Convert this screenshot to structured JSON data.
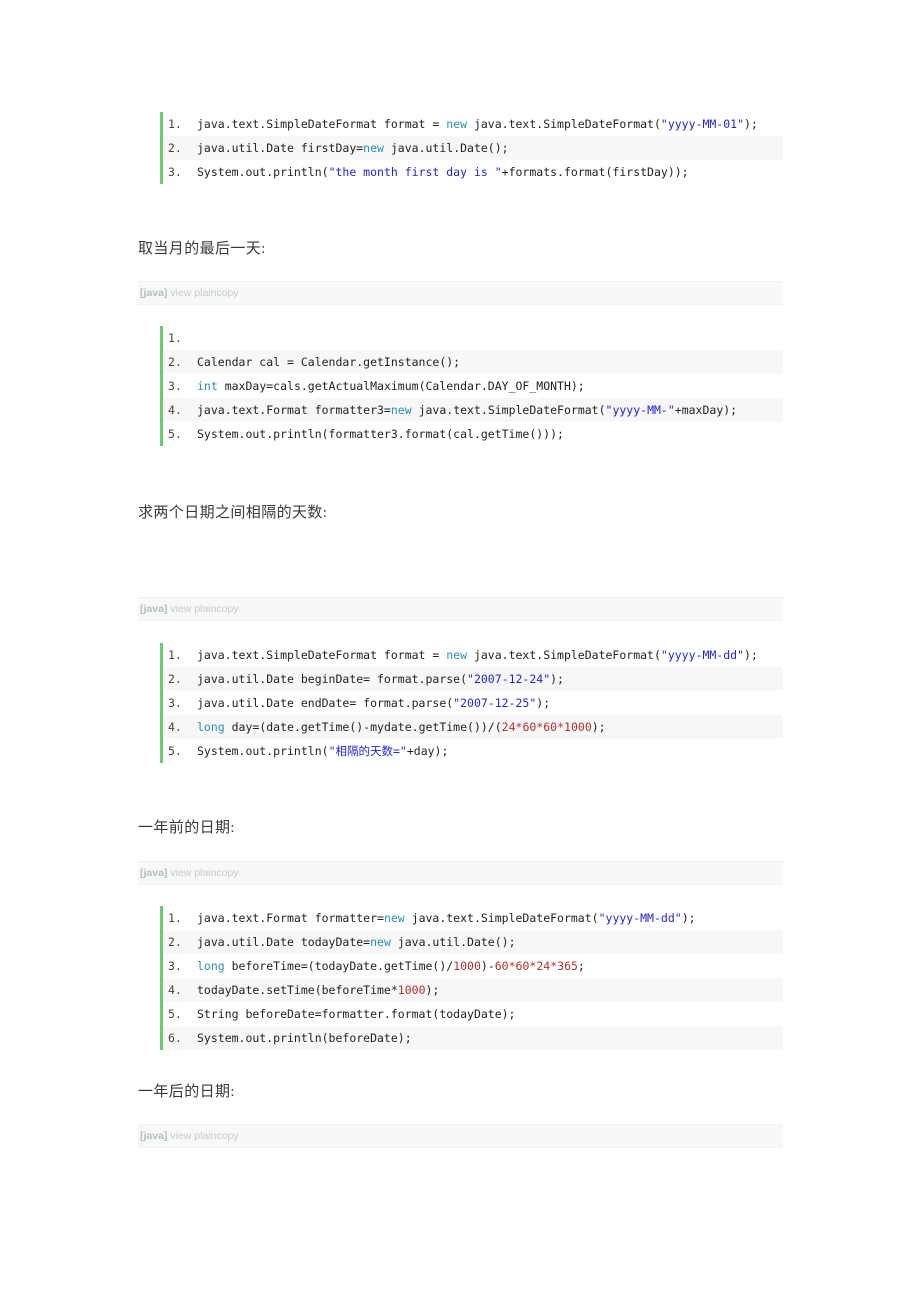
{
  "colors": {
    "keyword": "#2b91af",
    "string": "#2323dc",
    "number": "#b03030",
    "plain": "#1f1f1f",
    "code_accent_bar": "#6ccb6c",
    "toolbar_bg": "#f7f8f8",
    "alt_row_bg": "#f7f7f7",
    "heading_text": "#3a3a3a"
  },
  "toolbar": {
    "lang_label": "[java]",
    "view_label": " view plaincopy"
  },
  "sections": [
    {
      "id": "block-first-day",
      "heading": null,
      "toolbar": false,
      "lines": [
        {
          "num": "1.",
          "tokens": [
            {
              "t": "java.text.SimpleDateFormat format = ",
              "c": "p"
            },
            {
              "t": "new",
              "c": "k"
            },
            {
              "t": " java.text.SimpleDateFormat(",
              "c": "p"
            },
            {
              "t": "\"yyyy-MM-01\"",
              "c": "s"
            },
            {
              "t": ");",
              "c": "p"
            }
          ]
        },
        {
          "num": "2.",
          "tokens": [
            {
              "t": "java.util.Date firstDay=",
              "c": "p"
            },
            {
              "t": "new",
              "c": "k"
            },
            {
              "t": " java.util.Date();",
              "c": "p"
            }
          ]
        },
        {
          "num": "3.",
          "tokens": [
            {
              "t": "System.out.println(",
              "c": "p"
            },
            {
              "t": "\"the month first day is \"",
              "c": "s"
            },
            {
              "t": "+formats.format(firstDay));",
              "c": "p"
            }
          ]
        }
      ]
    },
    {
      "id": "block-last-day",
      "heading": "取当月的最后一天:",
      "toolbar": true,
      "lines": [
        {
          "num": "1.",
          "tokens": [
            {
              "t": "",
              "c": "p"
            }
          ]
        },
        {
          "num": "2.",
          "tokens": [
            {
              "t": "Calendar cal = Calendar.getInstance();",
              "c": "p"
            }
          ]
        },
        {
          "num": "3.",
          "tokens": [
            {
              "t": "int",
              "c": "k"
            },
            {
              "t": " maxDay=cals.getActualMaximum(Calendar.DAY_OF_MONTH);",
              "c": "p"
            }
          ]
        },
        {
          "num": "4.",
          "tokens": [
            {
              "t": "java.text.Format formatter3=",
              "c": "p"
            },
            {
              "t": "new",
              "c": "k"
            },
            {
              "t": " java.text.SimpleDateFormat(",
              "c": "p"
            },
            {
              "t": "\"yyyy-MM-\"",
              "c": "s"
            },
            {
              "t": "+maxDay);",
              "c": "p"
            }
          ]
        },
        {
          "num": "5.",
          "tokens": [
            {
              "t": "System.out.println(formatter3.format(cal.getTime()));",
              "c": "p"
            }
          ]
        }
      ]
    },
    {
      "id": "block-days-between",
      "heading": "求两个日期之间相隔的天数:",
      "toolbar": true,
      "lines": [
        {
          "num": "1.",
          "tokens": [
            {
              "t": "java.text.SimpleDateFormat format = ",
              "c": "p"
            },
            {
              "t": "new",
              "c": "k"
            },
            {
              "t": " java.text.SimpleDateFormat(",
              "c": "p"
            },
            {
              "t": "\"yyyy-MM-dd\"",
              "c": "s"
            },
            {
              "t": ");",
              "c": "p"
            }
          ]
        },
        {
          "num": "2.",
          "tokens": [
            {
              "t": "java.util.Date beginDate= format.parse(",
              "c": "p"
            },
            {
              "t": "\"2007-12-24\"",
              "c": "s"
            },
            {
              "t": ");",
              "c": "p"
            }
          ]
        },
        {
          "num": "3.",
          "tokens": [
            {
              "t": "java.util.Date endDate= format.parse(",
              "c": "p"
            },
            {
              "t": "\"2007-12-25\"",
              "c": "s"
            },
            {
              "t": ");",
              "c": "p"
            }
          ]
        },
        {
          "num": "4.",
          "tokens": [
            {
              "t": "long",
              "c": "k"
            },
            {
              "t": " day=(date.getTime()-mydate.getTime())/(",
              "c": "p"
            },
            {
              "t": "24",
              "c": "n"
            },
            {
              "t": "*",
              "c": "n"
            },
            {
              "t": "60",
              "c": "n"
            },
            {
              "t": "*",
              "c": "n"
            },
            {
              "t": "60",
              "c": "n"
            },
            {
              "t": "*",
              "c": "n"
            },
            {
              "t": "1000",
              "c": "n"
            },
            {
              "t": ");",
              "c": "p"
            }
          ]
        },
        {
          "num": "5.",
          "tokens": [
            {
              "t": "System.out.println(",
              "c": "p"
            },
            {
              "t": "\"相隔的天数=\"",
              "c": "s"
            },
            {
              "t": "+day);",
              "c": "p"
            }
          ]
        }
      ]
    },
    {
      "id": "block-one-year-before",
      "heading": "一年前的日期:",
      "toolbar": true,
      "lines": [
        {
          "num": "1.",
          "tokens": [
            {
              "t": "java.text.Format formatter=",
              "c": "p"
            },
            {
              "t": "new",
              "c": "k"
            },
            {
              "t": " java.text.SimpleDateFormat(",
              "c": "p"
            },
            {
              "t": "\"yyyy-MM-dd\"",
              "c": "s"
            },
            {
              "t": ");",
              "c": "p"
            }
          ]
        },
        {
          "num": "2.",
          "tokens": [
            {
              "t": "java.util.Date todayDate=",
              "c": "p"
            },
            {
              "t": "new",
              "c": "k"
            },
            {
              "t": " java.util.Date();",
              "c": "p"
            }
          ]
        },
        {
          "num": "3.",
          "tokens": [
            {
              "t": "long",
              "c": "k"
            },
            {
              "t": " beforeTime=(todayDate.getTime()/",
              "c": "p"
            },
            {
              "t": "1000",
              "c": "n"
            },
            {
              "t": ")-",
              "c": "p"
            },
            {
              "t": "60",
              "c": "n"
            },
            {
              "t": "*",
              "c": "n"
            },
            {
              "t": "60",
              "c": "n"
            },
            {
              "t": "*",
              "c": "n"
            },
            {
              "t": "24",
              "c": "n"
            },
            {
              "t": "*",
              "c": "n"
            },
            {
              "t": "365",
              "c": "n"
            },
            {
              "t": ";",
              "c": "p"
            }
          ]
        },
        {
          "num": "4.",
          "tokens": [
            {
              "t": "todayDate.setTime(beforeTime*",
              "c": "p"
            },
            {
              "t": "1000",
              "c": "n"
            },
            {
              "t": ");",
              "c": "p"
            }
          ]
        },
        {
          "num": "5.",
          "tokens": [
            {
              "t": "String beforeDate=formatter.format(todayDate);",
              "c": "p"
            }
          ]
        },
        {
          "num": "6.",
          "tokens": [
            {
              "t": "System.out.println(beforeDate);",
              "c": "p"
            }
          ]
        }
      ]
    },
    {
      "id": "block-one-year-after",
      "heading": "一年后的日期:",
      "toolbar": true,
      "lines": []
    }
  ]
}
